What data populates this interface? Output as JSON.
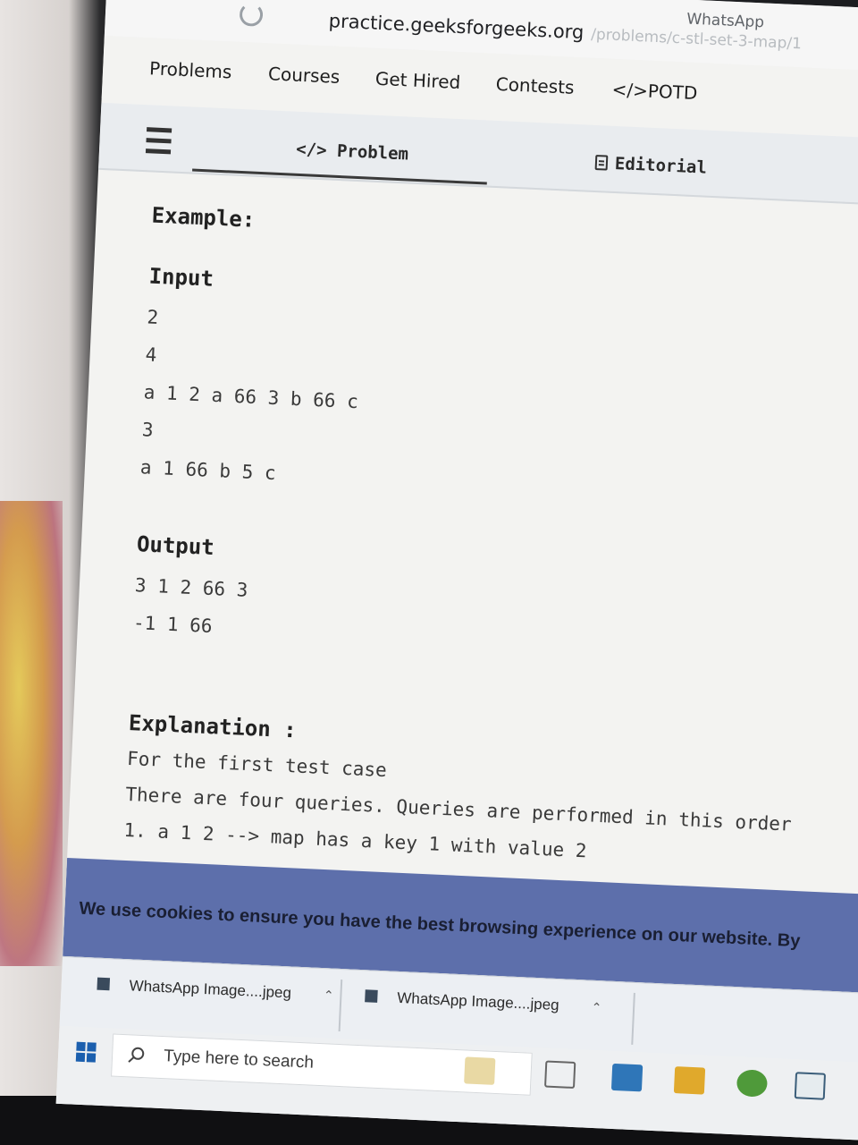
{
  "browser": {
    "url_host": "practice.geeksforgeeks.org",
    "url_path": "/problems/c-stl-set-3-map/1",
    "extension_label": "WhatsApp"
  },
  "site_nav": {
    "items": [
      "Problems",
      "Courses",
      "Get Hired",
      "Contests",
      "</>POTD"
    ]
  },
  "tabs": {
    "problem": "</> Problem",
    "editorial": "Editorial"
  },
  "content": {
    "example_heading": "Example:",
    "input_heading": "Input",
    "input_lines": [
      "2",
      "4",
      "a 1 2 a 66 3 b 66 c",
      "3",
      "a 1 66 b 5 c"
    ],
    "output_heading": "Output",
    "output_lines": [
      "3 1 2 66 3",
      "-1 1 66"
    ],
    "explanation_heading": "Explanation :",
    "explanation_lines": [
      "For the first test case",
      "There are four queries. Queries are performed in this order",
      "1. a 1 2  --> map has a key 1 with value 2"
    ]
  },
  "cookie_banner": {
    "text": "We use cookies to ensure you have the best browsing experience on our website. By"
  },
  "downloads": {
    "items": [
      "WhatsApp Image....jpeg",
      "WhatsApp Image....jpeg"
    ]
  },
  "taskbar": {
    "search_placeholder": "Type here to search"
  }
}
